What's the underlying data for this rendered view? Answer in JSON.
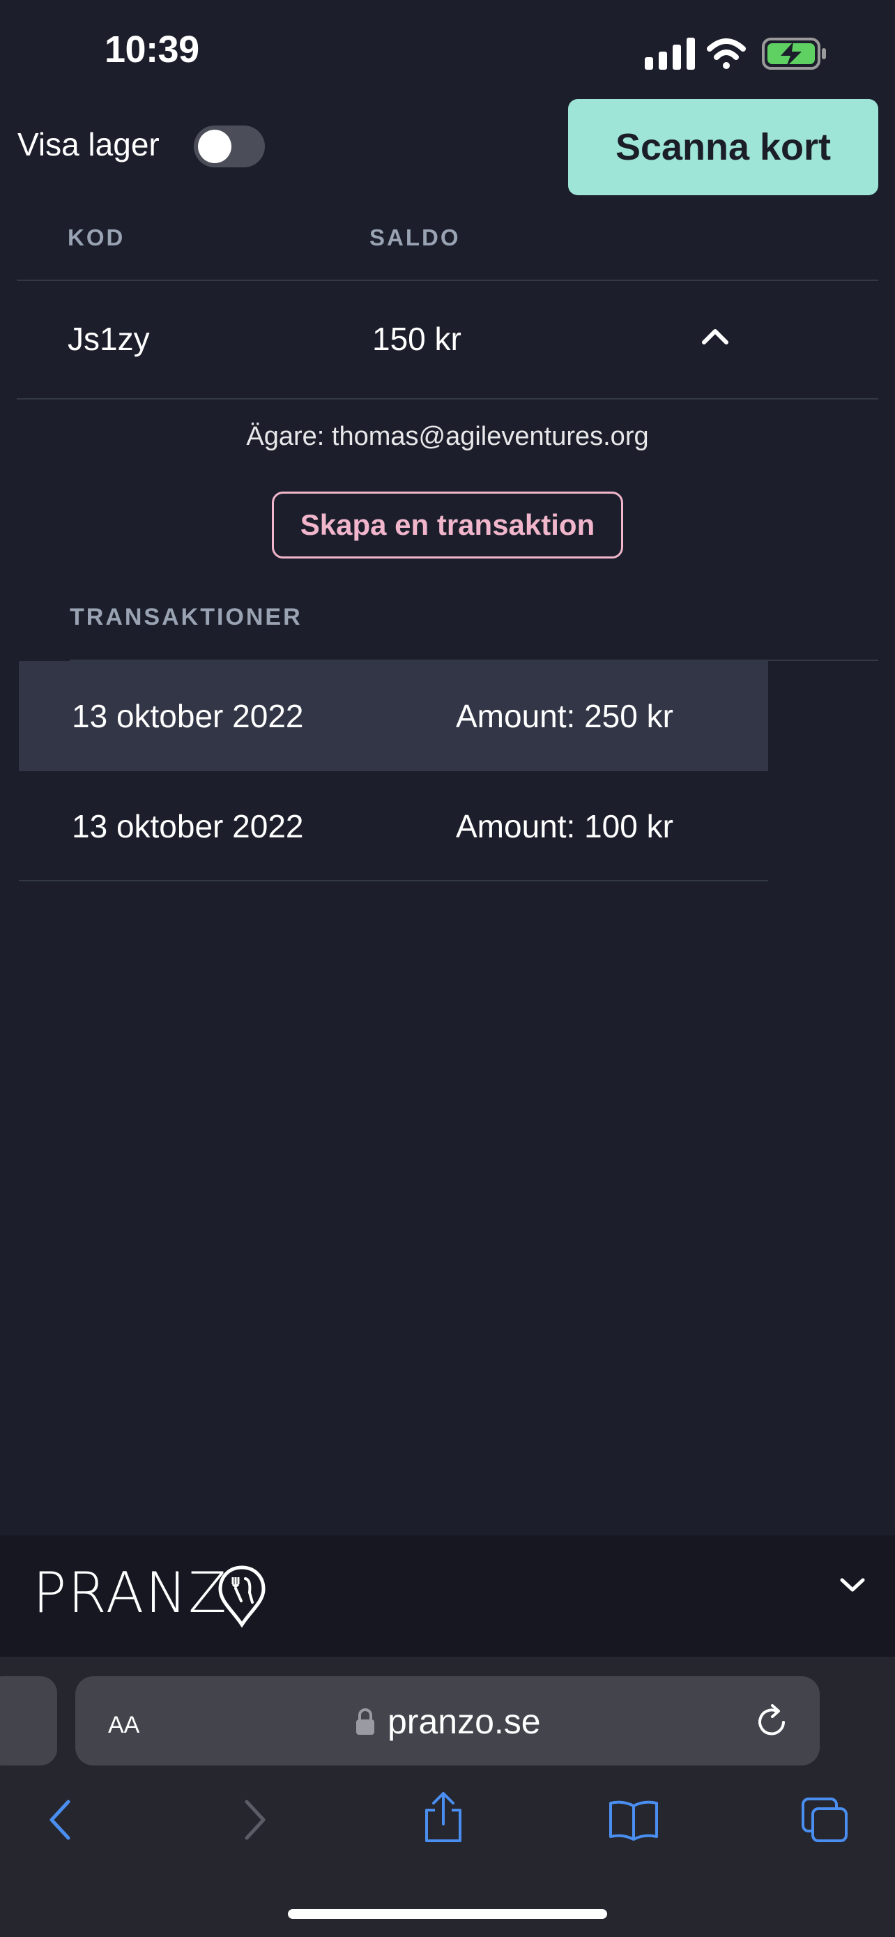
{
  "status_bar": {
    "time": "10:39",
    "icons": [
      "signal-icon",
      "wifi-icon",
      "battery-charging-icon"
    ]
  },
  "controls": {
    "toggle_label": "Visa lager",
    "toggle_on": false,
    "scan_button": "Scanna kort"
  },
  "cards_table": {
    "headers": [
      "KOD",
      "SALDO"
    ],
    "rows": [
      {
        "code": "Js1zy",
        "balance": "150 kr",
        "expanded": true
      }
    ]
  },
  "card_detail": {
    "owner": "Ägare: thomas@agileventures.org",
    "create_button": "Skapa en transaktion",
    "transactions_heading": "TRANSAKTIONER",
    "transactions": [
      {
        "date": "13 oktober 2022",
        "amount": "Amount: 250 kr",
        "highlighted": true
      },
      {
        "date": "13 oktober 2022",
        "amount": "Amount: 100 kr",
        "highlighted": false
      }
    ]
  },
  "site_bar": {
    "logo": "PRANZ",
    "collapse_icon": "chevron-down-icon"
  },
  "browser": {
    "text_size_button": "AA",
    "url": "pranzo.se",
    "toolbar_icons": [
      "back-icon",
      "forward-icon",
      "share-icon",
      "bookmarks-icon",
      "tabs-icon"
    ]
  },
  "colors": {
    "background": "#1c1f2b",
    "accent": "#9ee5d8",
    "pink": "#f1b6cc",
    "header_text": "#9aa3b3",
    "highlight_row": "#323646",
    "ios_blue": "#4a8ef0"
  }
}
